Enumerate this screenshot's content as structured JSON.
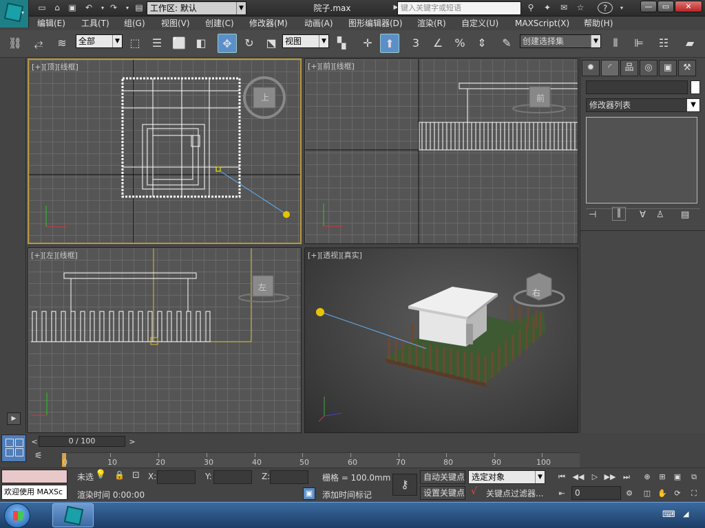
{
  "titlebar": {
    "workspace": "工作区: 默认",
    "filename": "院子.max",
    "search_placeholder": "键入关键字或短语"
  },
  "menu": [
    "编辑(E)",
    "工具(T)",
    "组(G)",
    "视图(V)",
    "创建(C)",
    "修改器(M)",
    "动画(A)",
    "图形编辑器(D)",
    "渲染(R)",
    "自定义(U)",
    "MAXScript(X)",
    "帮助(H)"
  ],
  "toolbar": {
    "selection_filter": "全部",
    "ref_coord": "视图",
    "snap_label": "3",
    "named_selection": "创建选择集"
  },
  "viewports": {
    "top": {
      "label": "[+][顶][线框]",
      "cube": "上"
    },
    "front": {
      "label": "[+][前][线框]",
      "cube": "前"
    },
    "left": {
      "label": "[+][左][线框]",
      "cube": "左"
    },
    "persp": {
      "label": "[+][透视][真实]",
      "cube": "右"
    }
  },
  "command_panel": {
    "modifier_list": "修改器列表"
  },
  "timeline": {
    "slider": "0 / 100",
    "ticks": [
      "0",
      "10",
      "20",
      "30",
      "40",
      "50",
      "60",
      "70",
      "80",
      "90",
      "100"
    ]
  },
  "status": {
    "welcome": "欢迎使用 MAXSc",
    "none_selected": "未选",
    "render_time": "渲染时间 0:00:00",
    "grid": "栅格 = 100.0mm",
    "add_time_tag": "添加时间标记",
    "auto_key": "自动关键点",
    "set_key": "设置关键点",
    "selected_object": "选定对象",
    "key_filters": "关键点过滤器...",
    "frame": "0",
    "x_label": "X:",
    "y_label": "Y:",
    "z_label": "Z:"
  },
  "colors": {
    "accent": "#5c8fc8",
    "active_border": "#b89a3c",
    "taskbar": "#2a5186"
  }
}
